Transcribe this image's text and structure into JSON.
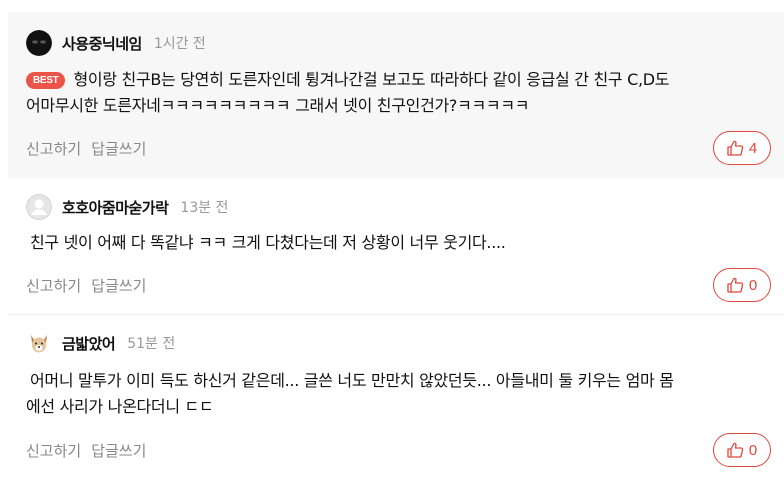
{
  "comments": [
    {
      "nickname": "사용중닉네임",
      "time": "1시간 전",
      "badge": "BEST",
      "line1": "형이랑 친구B는 당연히 도른자인데 튕겨나간걸 보고도 따라하다 같이 응급실 간 친구 C,D도",
      "line2": "어마무시한 도른자네ㅋㅋㅋㅋㅋㅋㅋㅋㅋ 그래서 넷이 친구인건가?ㅋㅋㅋㅋㅋ",
      "report": "신고하기",
      "reply": "답글쓰기",
      "likes": "4"
    },
    {
      "nickname": "호호아줌마숟가락",
      "time": "13분 전",
      "line1": "친구 넷이 어째 다 똑같냐 ㅋㅋ 크게 다쳤다는데 저 상황이 너무 웃기다....",
      "report": "신고하기",
      "reply": "답글쓰기",
      "likes": "0"
    },
    {
      "nickname": "금밟았어",
      "time": "51분 전",
      "line1": "어머니 말투가 이미 득도 하신거 같은데... 글쓴 너도 만만치 않았던듯... 아들내미 둘 키우는 엄마 몸",
      "line2": "에선 사리가 나온다더니 ㄷㄷ",
      "report": "신고하기",
      "reply": "답글쓰기",
      "likes": "0"
    }
  ],
  "icons": {
    "like": "thumbs-up-icon"
  },
  "colors": {
    "accent": "#e0483e",
    "best_badge": "#ea5449",
    "best_bg": "#f7f7f7"
  }
}
